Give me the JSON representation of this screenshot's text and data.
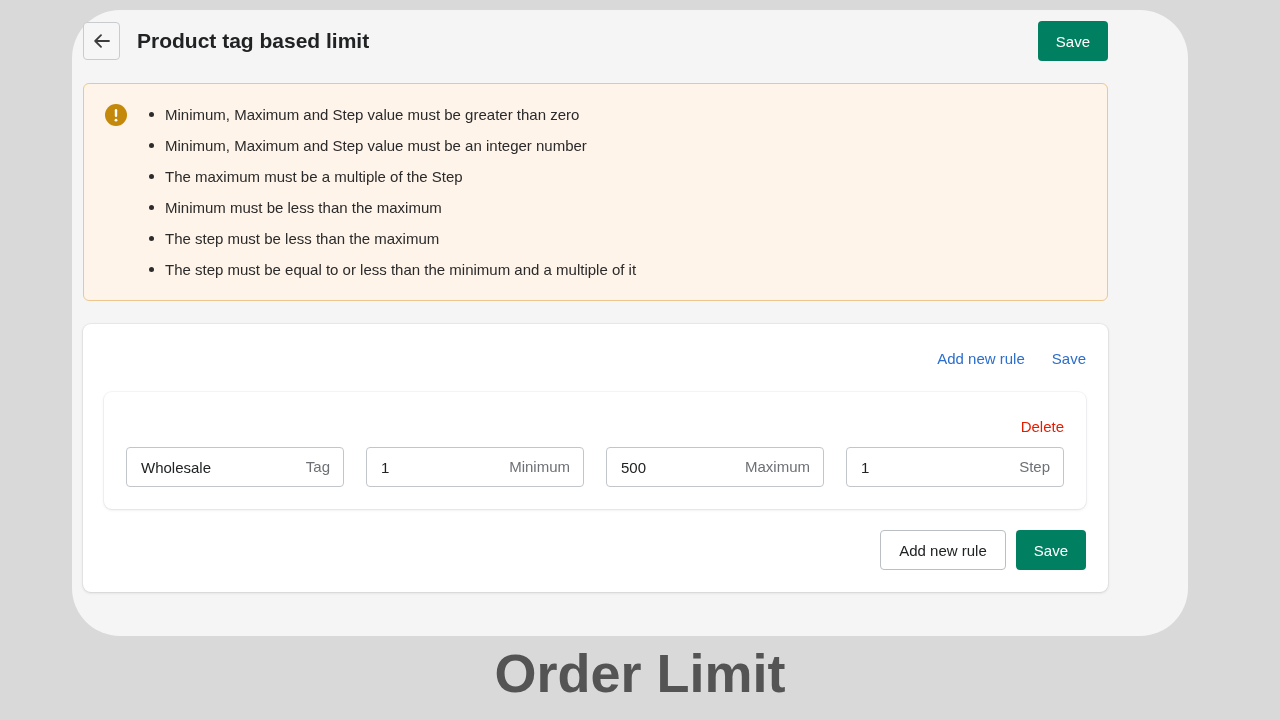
{
  "header": {
    "title": "Product tag based limit",
    "buttons": [
      {
        "label": "Save",
        "kind": "primary"
      }
    ]
  },
  "banner": {
    "items": [
      "Minimum, Maximum and Step value must be greater than zero",
      "Minimum, Maximum and Step value must be an integer number",
      "The maximum must be a multiple of the Step",
      "Minimum must be less than the maximum",
      "The step must be less than the maximum",
      "The step must be equal to or less than the minimum and a multiple of it"
    ]
  },
  "rules_card": {
    "links": [
      "Add new rule",
      "Save"
    ],
    "rules": [
      {
        "delete": "Delete",
        "fields": [
          {
            "value": "Wholesale",
            "suffix": "Tag"
          },
          {
            "value": "1",
            "suffix": "Minimum"
          },
          {
            "value": "500",
            "suffix": "Maximum"
          },
          {
            "value": "1",
            "suffix": "Step"
          }
        ]
      }
    ],
    "buttons": [
      {
        "label": "Add new rule",
        "kind": "secondary"
      },
      {
        "label": "Save",
        "kind": "primary"
      }
    ]
  },
  "caption": "Order Limit"
}
